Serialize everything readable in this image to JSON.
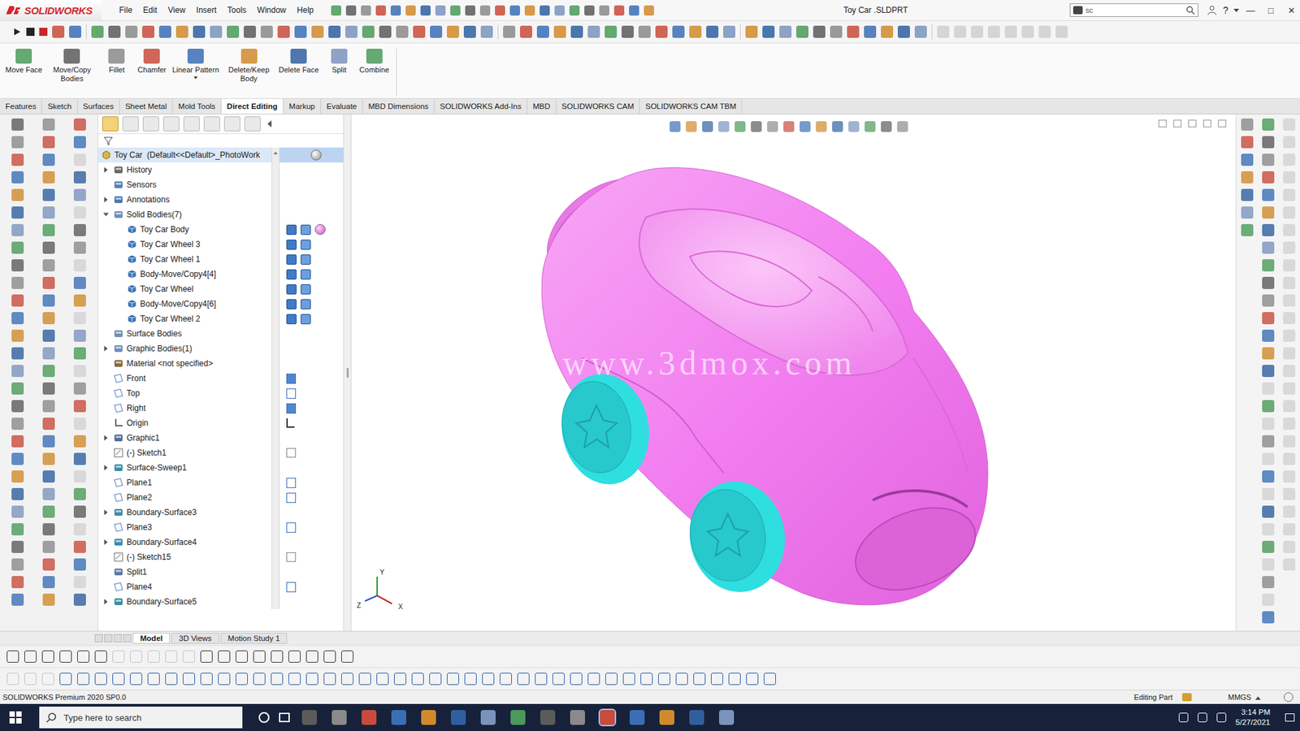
{
  "app": {
    "logo": "SOLIDWORKS",
    "title": "Toy Car .SLDPRT",
    "search_value": "sc",
    "help": "?",
    "window_controls": [
      "—",
      "□",
      "✕"
    ]
  },
  "menu": [
    "File",
    "Edit",
    "View",
    "Insert",
    "Tools",
    "Window",
    "Help"
  ],
  "command_buttons": [
    {
      "label": "Move Face",
      "has_menu": false
    },
    {
      "label": "Move/Copy Bodies",
      "has_menu": false
    },
    {
      "label": "Fillet",
      "has_menu": false
    },
    {
      "label": "Chamfer",
      "has_menu": false
    },
    {
      "label": "Linear Pattern",
      "has_menu": true
    },
    {
      "label": "Delete/Keep Body",
      "has_menu": false
    },
    {
      "label": "Delete Face",
      "has_menu": false
    },
    {
      "label": "Split",
      "has_menu": false
    },
    {
      "label": "Combine",
      "has_menu": false
    }
  ],
  "tabs": [
    {
      "label": "Features",
      "selected": false
    },
    {
      "label": "Sketch",
      "selected": false
    },
    {
      "label": "Surfaces",
      "selected": false
    },
    {
      "label": "Sheet Metal",
      "selected": false
    },
    {
      "label": "Mold Tools",
      "selected": false
    },
    {
      "label": "Direct Editing",
      "selected": true
    },
    {
      "label": "Markup",
      "selected": false
    },
    {
      "label": "Evaluate",
      "selected": false
    },
    {
      "label": "MBD Dimensions",
      "selected": false
    },
    {
      "label": "SOLIDWORKS Add-Ins",
      "selected": false
    },
    {
      "label": "MBD",
      "selected": false
    },
    {
      "label": "SOLIDWORKS CAM",
      "selected": false
    },
    {
      "label": "SOLIDWORKS CAM TBM",
      "selected": false
    }
  ],
  "feature_tree": {
    "root": {
      "label": "Toy Car  (Default<<Default>_PhotoWork",
      "pane": "appearance"
    },
    "items": [
      {
        "label": "History",
        "icon": "history",
        "level": 0,
        "expandable": true,
        "expanded": false,
        "pane": "none"
      },
      {
        "label": "Sensors",
        "icon": "sensor",
        "level": 0,
        "expandable": false,
        "expanded": false,
        "pane": "none"
      },
      {
        "label": "Annotations",
        "icon": "annotation",
        "level": 0,
        "expandable": true,
        "expanded": false,
        "pane": "none"
      },
      {
        "label": "Solid Bodies(7)",
        "icon": "folder",
        "level": 0,
        "expandable": true,
        "expanded": true,
        "pane": "none"
      },
      {
        "label": "Toy Car Body",
        "icon": "body",
        "level": 1,
        "expandable": false,
        "expanded": false,
        "pane": "body-appearance"
      },
      {
        "label": "Toy Car Wheel 3",
        "icon": "body",
        "level": 1,
        "expandable": false,
        "expanded": false,
        "pane": "body"
      },
      {
        "label": "Toy Car Wheel 1",
        "icon": "body",
        "level": 1,
        "expandable": false,
        "expanded": false,
        "pane": "body"
      },
      {
        "label": "Body-Move/Copy4[4]",
        "icon": "body",
        "level": 1,
        "expandable": false,
        "expanded": false,
        "pane": "body"
      },
      {
        "label": "Toy Car Wheel",
        "icon": "body",
        "level": 1,
        "expandable": false,
        "expanded": false,
        "pane": "body"
      },
      {
        "label": "Body-Move/Copy4[6]",
        "icon": "body",
        "level": 1,
        "expandable": false,
        "expanded": false,
        "pane": "body"
      },
      {
        "label": "Toy Car Wheel 2",
        "icon": "body",
        "level": 1,
        "expandable": false,
        "expanded": false,
        "pane": "body"
      },
      {
        "label": "Surface Bodies",
        "icon": "folder",
        "level": 0,
        "expandable": false,
        "expanded": false,
        "pane": "none"
      },
      {
        "label": "Graphic Bodies(1)",
        "icon": "folder",
        "level": 0,
        "expandable": true,
        "expanded": false,
        "pane": "none"
      },
      {
        "label": "Material <not specified>",
        "icon": "material",
        "level": 0,
        "expandable": false,
        "expanded": false,
        "pane": "none"
      },
      {
        "label": "Front",
        "icon": "plane",
        "level": 0,
        "expandable": false,
        "expanded": false,
        "pane": "plane-visible"
      },
      {
        "label": "Top",
        "icon": "plane",
        "level": 0,
        "expandable": false,
        "expanded": false,
        "pane": "plane"
      },
      {
        "label": "Right",
        "icon": "plane",
        "level": 0,
        "expandable": false,
        "expanded": false,
        "pane": "plane-visible"
      },
      {
        "label": "Origin",
        "icon": "origin",
        "level": 0,
        "expandable": false,
        "expanded": false,
        "pane": "origin"
      },
      {
        "label": "Graphic1",
        "icon": "graphic",
        "level": 0,
        "expandable": true,
        "expanded": false,
        "pane": "none"
      },
      {
        "label": "(-) Sketch1",
        "icon": "sketch",
        "level": 0,
        "expandable": false,
        "expanded": false,
        "pane": "sketch"
      },
      {
        "label": "Surface-Sweep1",
        "icon": "surface",
        "level": 0,
        "expandable": true,
        "expanded": false,
        "pane": "none"
      },
      {
        "label": "Plane1",
        "icon": "plane",
        "level": 0,
        "expandable": false,
        "expanded": false,
        "pane": "plane"
      },
      {
        "label": "Plane2",
        "icon": "plane",
        "level": 0,
        "expandable": false,
        "expanded": false,
        "pane": "plane"
      },
      {
        "label": "Boundary-Surface3",
        "icon": "surface",
        "level": 0,
        "expandable": true,
        "expanded": false,
        "pane": "none"
      },
      {
        "label": "Plane3",
        "icon": "plane",
        "level": 0,
        "expandable": false,
        "expanded": false,
        "pane": "plane"
      },
      {
        "label": "Boundary-Surface4",
        "icon": "surface",
        "level": 0,
        "expandable": true,
        "expanded": false,
        "pane": "none"
      },
      {
        "label": "(-) Sketch15",
        "icon": "sketch",
        "level": 0,
        "expandable": false,
        "expanded": false,
        "pane": "sketch"
      },
      {
        "label": "Split1",
        "icon": "split",
        "level": 0,
        "expandable": false,
        "expanded": false,
        "pane": "none"
      },
      {
        "label": "Plane4",
        "icon": "plane",
        "level": 0,
        "expandable": false,
        "expanded": false,
        "pane": "plane"
      },
      {
        "label": "Boundary-Surface5",
        "icon": "surface",
        "level": 0,
        "expandable": true,
        "expanded": false,
        "pane": "none"
      }
    ]
  },
  "viewport": {
    "watermark": "www.3dmox.com",
    "triad": [
      "X",
      "Y",
      "Z"
    ]
  },
  "bottom_tabs": [
    {
      "label": "Model",
      "selected": true
    },
    {
      "label": "3D Views",
      "selected": false
    },
    {
      "label": "Motion Study 1",
      "selected": false
    }
  ],
  "status_bar": {
    "product": "SOLIDWORKS Premium 2020 SP0.0",
    "mode": "Editing Part",
    "units": "MMGS"
  },
  "taskbar": {
    "search_placeholder": "Type here to search",
    "time": "3:14 PM",
    "date": "5/27/2021"
  }
}
